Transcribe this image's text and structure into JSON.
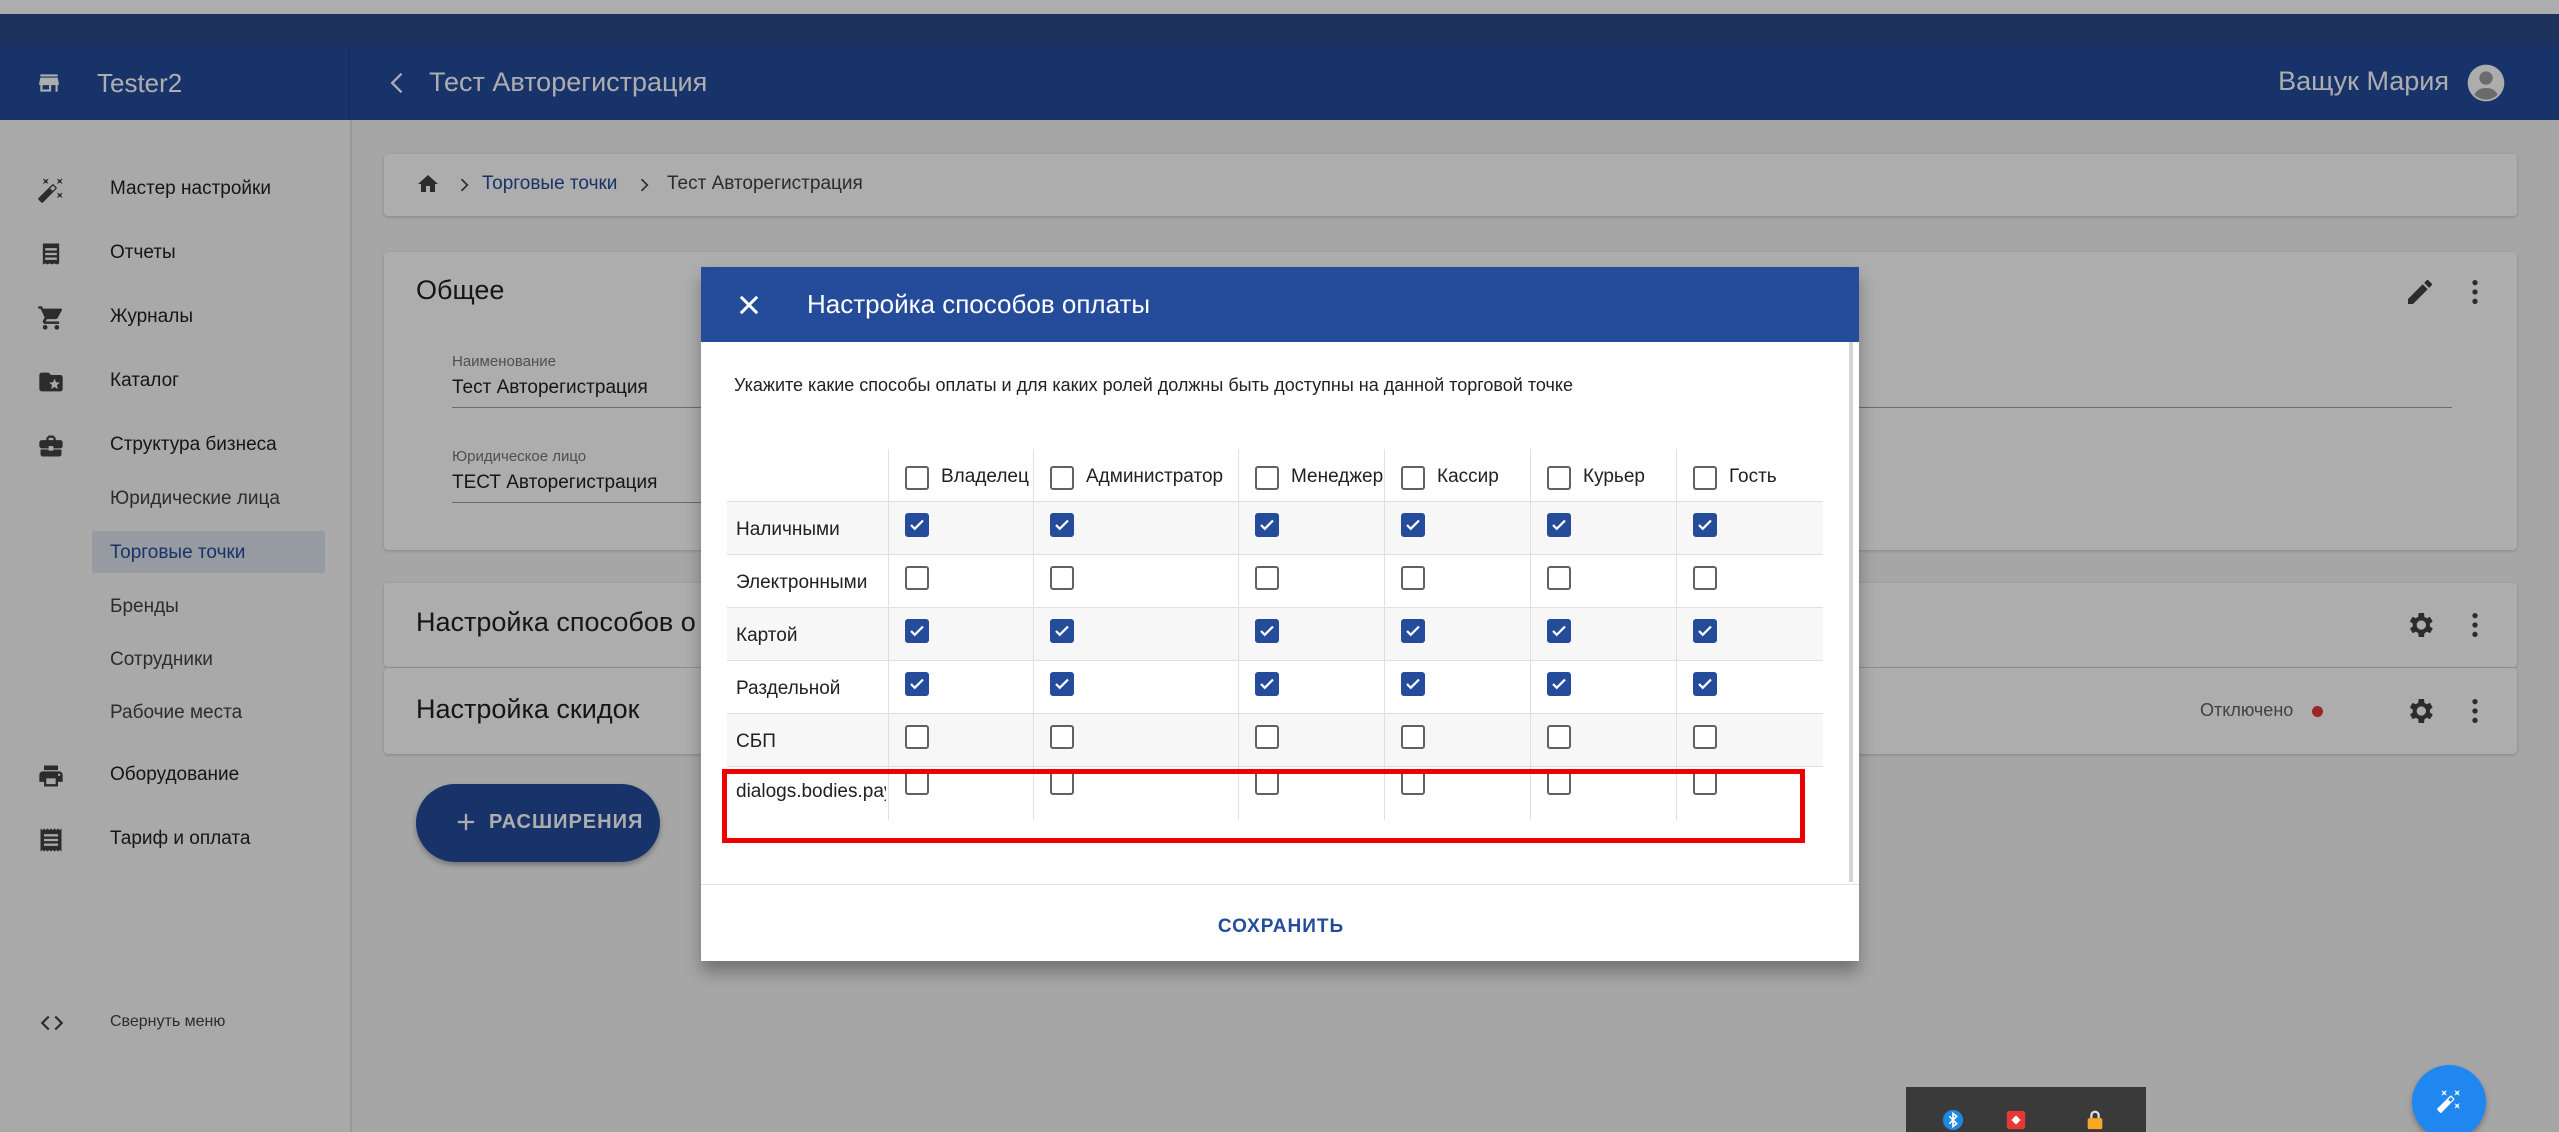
{
  "app": {
    "brand": "Tester2",
    "page_title": "Тест Авторегистрация",
    "user_name": "Ващук Мария"
  },
  "sidebar": {
    "items": [
      {
        "label": "Мастер настройки",
        "icon": "magic-wand-icon"
      },
      {
        "label": "Отчеты",
        "icon": "receipt-icon"
      },
      {
        "label": "Журналы",
        "icon": "cart-icon"
      },
      {
        "label": "Каталог",
        "icon": "folder-star-icon"
      },
      {
        "label": "Структура бизнеса",
        "icon": "briefcase-icon"
      },
      {
        "label": "Оборудование",
        "icon": "printer-icon"
      },
      {
        "label": "Тариф и оплата",
        "icon": "billing-icon"
      }
    ],
    "sub_items": [
      {
        "label": "Юридические лица"
      },
      {
        "label": "Торговые точки"
      },
      {
        "label": "Бренды"
      },
      {
        "label": "Сотрудники"
      },
      {
        "label": "Рабочие места"
      }
    ],
    "collapse_label": "Свернуть меню"
  },
  "breadcrumb": {
    "items": [
      "Торговые точки",
      "Тест Авторегистрация"
    ]
  },
  "general_card": {
    "title": "Общее",
    "name_label": "Наименование",
    "name_value": "Тест Авторегистрация",
    "legal_label": "Юридическое лицо",
    "legal_value": "ТЕСТ Авторегистрация"
  },
  "payment_card": {
    "title": "Настройка способов о"
  },
  "discount_card": {
    "title": "Настройка скидок",
    "status": "Отключено",
    "status_color": "#e53935"
  },
  "extensions_button": {
    "label": "РАСШИРЕНИЯ"
  },
  "dialog": {
    "title": "Настройка способов оплаты",
    "description": "Укажите какие способы оплаты и для каких ролей должны быть доступны на данной торговой точке",
    "roles": [
      "Владелец",
      "Администратор",
      "Менеджер",
      "Кассир",
      "Курьер",
      "Гость"
    ],
    "rows": [
      {
        "label": "Наличными",
        "values": [
          true,
          true,
          true,
          true,
          true,
          true
        ]
      },
      {
        "label": "Электронными",
        "values": [
          false,
          false,
          false,
          false,
          false,
          false
        ]
      },
      {
        "label": "Картой",
        "values": [
          true,
          true,
          true,
          true,
          true,
          true
        ]
      },
      {
        "label": "Раздельной",
        "values": [
          true,
          true,
          true,
          true,
          true,
          true
        ]
      },
      {
        "label": "СБП",
        "values": [
          false,
          false,
          false,
          false,
          false,
          false
        ]
      },
      {
        "label": "dialogs.bodies.pay",
        "values": [
          false,
          false,
          false,
          false,
          false,
          false
        ]
      }
    ],
    "save_label": "СОХРАНИТЬ"
  },
  "colors": {
    "primary": "#244c9b",
    "highlight": "#ee0000",
    "fab": "#2187f0"
  }
}
